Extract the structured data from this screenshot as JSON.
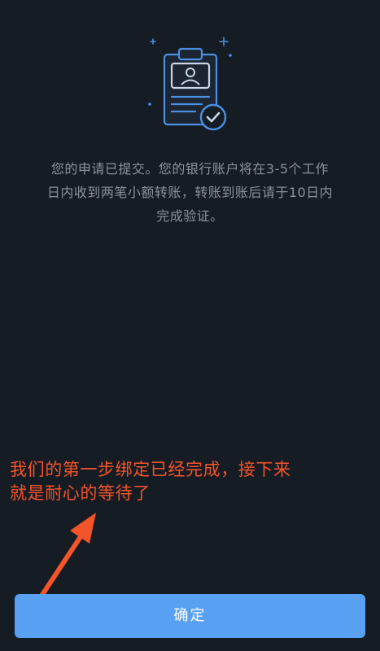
{
  "message": {
    "lines": [
      "您的申请已提交。您的银行账户将在3-5个工作",
      "日内收到两笔小额转账，转账到账后请于10日内",
      "完成验证。"
    ]
  },
  "annotation": {
    "lines": [
      "我们的第一步绑定已经完成，接下来",
      "就是耐心的等待了"
    ],
    "color": "#f4542a"
  },
  "confirm_button": {
    "label": "确定",
    "color": "#5aa0f2"
  },
  "illustration": {
    "icon": "clipboard-verified-icon",
    "accent": "#4a90e2"
  },
  "background": "#161c24"
}
